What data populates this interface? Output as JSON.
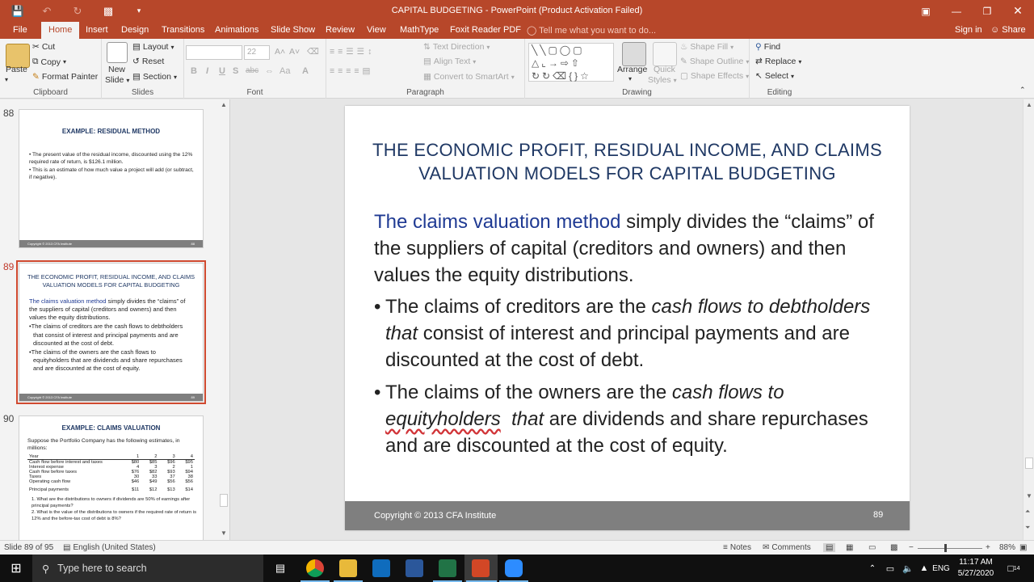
{
  "window": {
    "title": "CAPITAL BUDGETING - PowerPoint (Product Activation Failed)",
    "controls": [
      "restore-ribbon",
      "minimize",
      "maximize",
      "close"
    ]
  },
  "tabs": [
    "File",
    "Home",
    "Insert",
    "Design",
    "Transitions",
    "Animations",
    "Slide Show",
    "Review",
    "View",
    "MathType",
    "Foxit Reader PDF"
  ],
  "active_tab": "Home",
  "tell_me": "Tell me what you want to do...",
  "sign_in": "Sign in",
  "share": "Share",
  "ribbon": {
    "clipboard": {
      "label": "Clipboard",
      "paste": "Paste",
      "cut": "Cut",
      "copy": "Copy",
      "format_painter": "Format Painter"
    },
    "slides": {
      "label": "Slides",
      "new_slide_1": "New",
      "new_slide_2": "Slide",
      "layout": "Layout",
      "reset": "Reset",
      "section": "Section"
    },
    "font": {
      "label": "Font",
      "font_size": "22",
      "bold": "B",
      "italic": "I",
      "underline": "U",
      "shadow": "S",
      "strike": "abc"
    },
    "paragraph": {
      "label": "Paragraph",
      "text_direction": "Text Direction",
      "align_text": "Align Text",
      "convert_smartart": "Convert to SmartArt"
    },
    "drawing": {
      "label": "Drawing",
      "arrange": "Arrange",
      "quick_styles_1": "Quick",
      "quick_styles_2": "Styles",
      "shape_fill": "Shape Fill",
      "shape_outline": "Shape Outline",
      "shape_effects": "Shape Effects"
    },
    "editing": {
      "label": "Editing",
      "find": "Find",
      "replace": "Replace",
      "select": "Select"
    }
  },
  "thumbnails": [
    {
      "number": "88",
      "title": "EXAMPLE: RESIDUAL METHOD",
      "bullets": [
        "The present value of the residual income, discounted using the 12% required rate of return, is $126.1 million.",
        "This is an estimate of how much value a project will add (or subtract, if negative)."
      ],
      "footer": "Copyright © 2013 CFA Institute",
      "page": "88"
    },
    {
      "number": "89",
      "title": "THE ECONOMIC PROFIT, RESIDUAL INCOME, AND CLAIMS VALUATION MODELS FOR CAPITAL BUDGETING",
      "intro_blue": "The claims valuation method",
      "intro_rest": " simply divides the “claims” of the suppliers of capital (creditors and owners) and then values the equity distributions.",
      "bullet1": "The claims of creditors are the cash flows to debtholders that consist of interest and principal payments and are discounted at the cost of debt.",
      "bullet2": "The claims of the owners are the cash flows to equityholders that are dividends and share repurchases and are discounted at the cost of equity.",
      "footer": "Copyright © 2013 CFA Institute",
      "page": "89"
    },
    {
      "number": "90",
      "title": "EXAMPLE: CLAIMS VALUATION",
      "intro": "Suppose the Portfolio Company has the following estimates, in millions:",
      "table": [
        [
          "Year",
          "1",
          "2",
          "3",
          "4"
        ],
        [
          "Cash flow before interest and taxes",
          "$80",
          "$85",
          "$96",
          "$95"
        ],
        [
          "Interest expense",
          "4",
          "3",
          "2",
          "1"
        ],
        [
          "Cash flow before taxes",
          "$76",
          "$82",
          "$93",
          "$94"
        ],
        [
          "Taxes",
          "30",
          "33",
          "37",
          "38"
        ],
        [
          "Operating cash flow",
          "$46",
          "$49",
          "$56",
          "$56"
        ],
        [
          "Principal payments",
          "$11",
          "$12",
          "$13",
          "$14"
        ]
      ],
      "q1": "1. What are the distributions to owners if dividends are 50% of earnings after principal payments?",
      "q2": "2. What is the value of the distributions to owners if the required rate of return is 12% and the before-tax cost of debt is 8%?"
    }
  ],
  "slide": {
    "title": "THE ECONOMIC PROFIT, RESIDUAL INCOME, AND CLAIMS VALUATION MODELS FOR CAPITAL BUDGETING",
    "intro_blue": "The claims valuation method",
    "intro_rest": " simply divides the “claims” of the suppliers of capital (creditors and owners) and then values the equity distributions.",
    "bullet1": {
      "a": "The claims of creditors are the ",
      "italic": "cash flows to debtholders that",
      "b": " consist of interest and principal payments and are discounted at the cost of debt."
    },
    "bullet2": {
      "a": "The claims of the owners are the ",
      "italic1": "cash flows to ",
      "italic_sq": "equityholders",
      "italic2": "  that",
      "b": " are dividends and share repurchases and are discounted at the cost of equity."
    },
    "footer": "Copyright © 2013 CFA Institute",
    "page": "89"
  },
  "status": {
    "slide_of": "Slide 89 of 95",
    "language": "English (United States)",
    "notes": "Notes",
    "comments": "Comments",
    "zoom": "88%"
  },
  "taskbar": {
    "search_placeholder": "Type here to search",
    "lang": "ENG",
    "time": "11:17 AM",
    "date": "5/27/2020",
    "notifications": "14"
  }
}
